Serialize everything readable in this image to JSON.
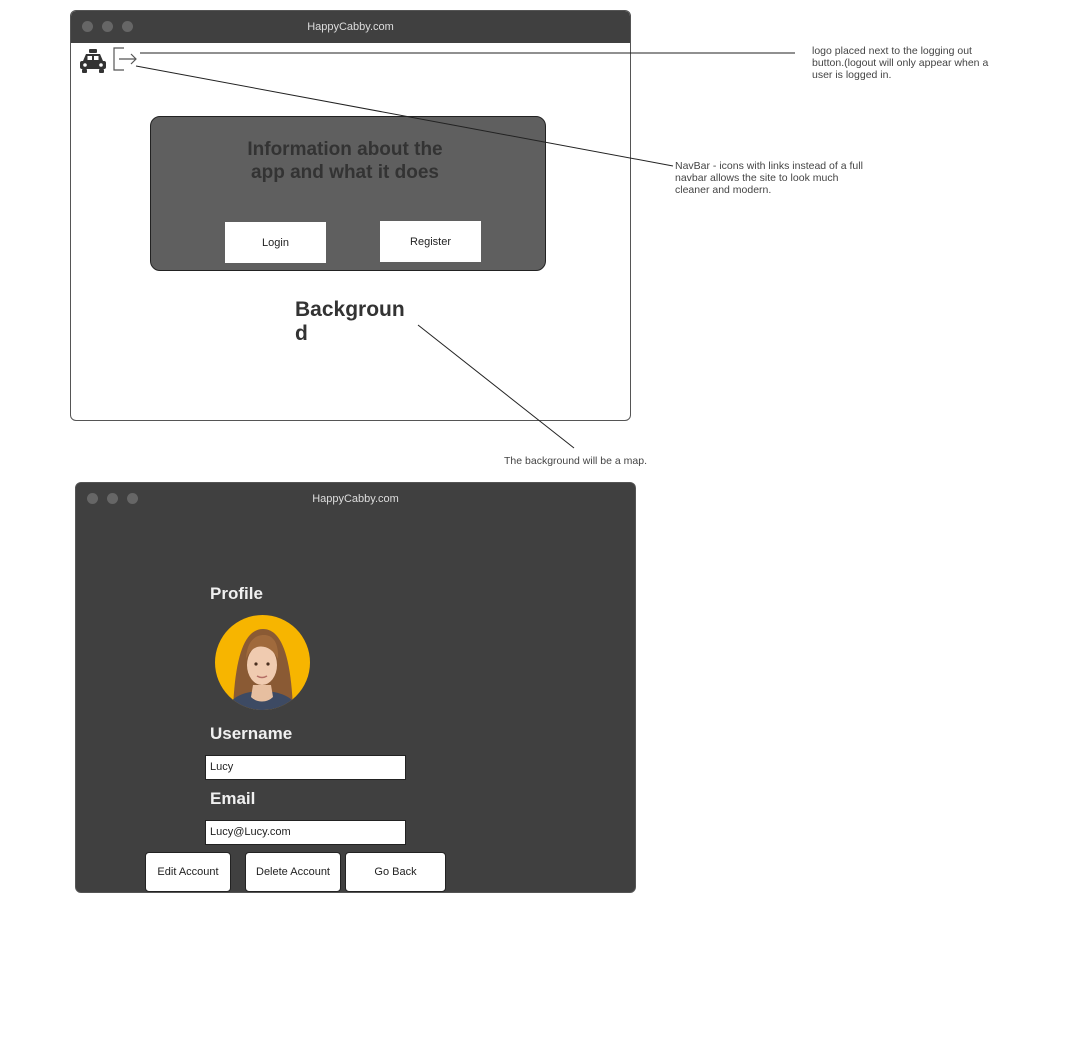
{
  "window1": {
    "title": "HappyCabby.com",
    "info_text": "Information about the app and what it does",
    "login_label": "Login",
    "register_label": "Register",
    "background_label": "Background"
  },
  "annotations": {
    "logo_note": "logo placed next to the logging out button.(logout will only appear when a user is logged in.",
    "navbar_note": "NavBar - icons with links instead of a full navbar allows the site to look much cleaner and modern.",
    "background_note": "The background will be a map."
  },
  "window2": {
    "title": "HappyCabby.com",
    "profile_heading": "Profile",
    "username_label": "Username",
    "username_value": "Lucy",
    "email_label": "Email",
    "email_value": "Lucy@Lucy.com",
    "edit_label": "Edit Account",
    "delete_label": "Delete Account",
    "back_label": "Go Back"
  },
  "colors": {
    "titlebar": "#404040",
    "panel": "#5f5f5f",
    "window2_bg": "#404040",
    "avatar_bg": "#f7b500"
  },
  "icons": [
    "taxi-icon",
    "logout-icon"
  ]
}
